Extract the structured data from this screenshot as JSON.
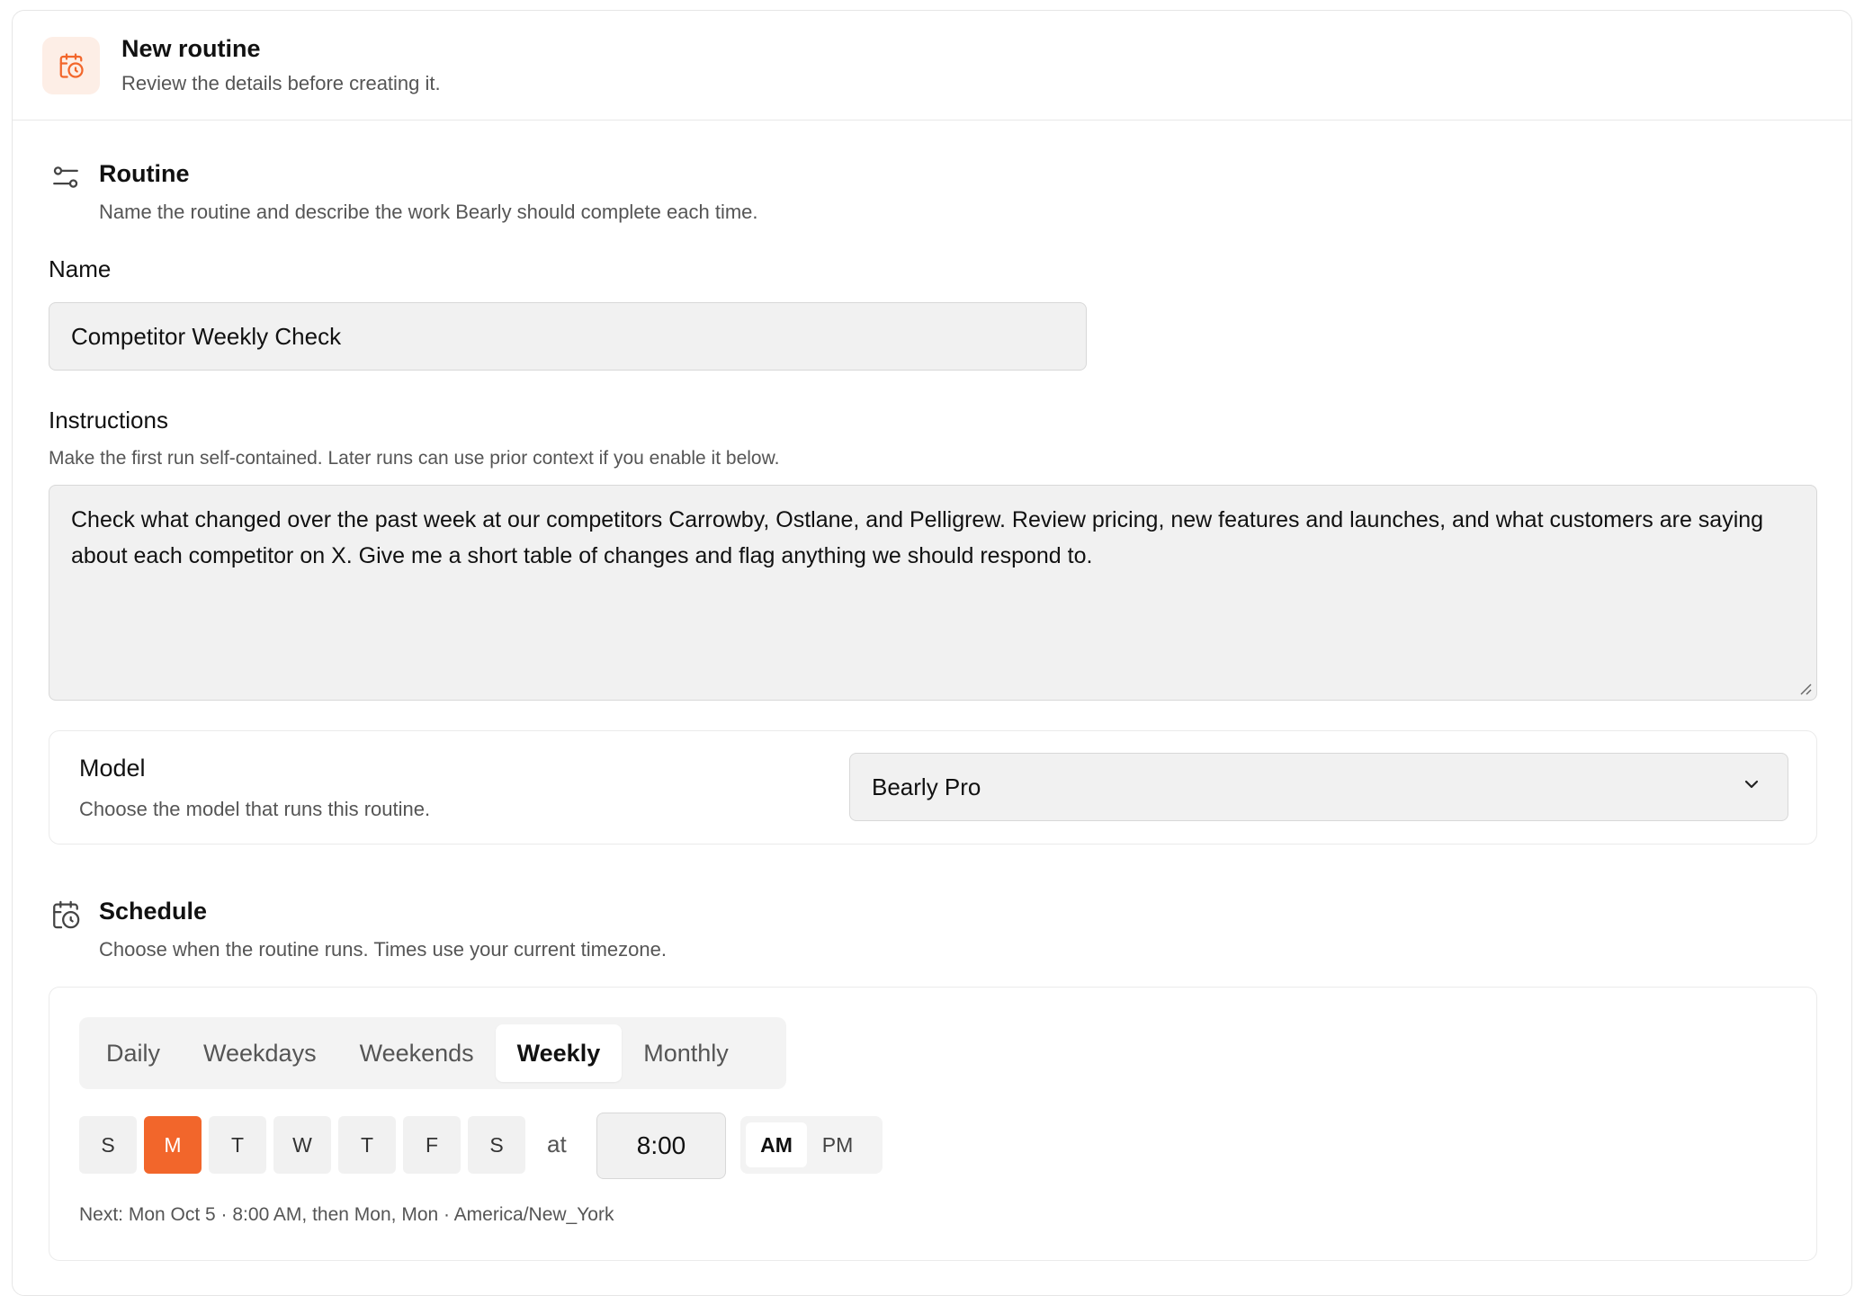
{
  "header": {
    "title": "New routine",
    "subtitle": "Review the details before creating it.",
    "icon": "calendar-clock-icon",
    "accent": "#f2662b"
  },
  "routine": {
    "title": "Routine",
    "subtitle": "Name the routine and describe the work Bearly should complete each time.",
    "name_label": "Name",
    "name_value": "Competitor Weekly Check",
    "instructions_label": "Instructions",
    "instructions_hint": "Make the first run self-contained. Later runs can use prior context if you enable it below.",
    "instructions_value": "Check what changed over the past week at our competitors Carrowby, Ostlane, and Pelligrew. Review pricing, new features and launches, and what customers are saying about each competitor on X. Give me a short table of changes and flag anything we should respond to."
  },
  "model": {
    "title": "Model",
    "subtitle": "Choose the model that runs this routine.",
    "selected": "Bearly Pro"
  },
  "schedule": {
    "title": "Schedule",
    "subtitle": "Choose when the routine runs. Times use your current timezone.",
    "tabs": [
      "Daily",
      "Weekdays",
      "Weekends",
      "Weekly",
      "Monthly"
    ],
    "active_tab": "Weekly",
    "days": [
      "S",
      "M",
      "T",
      "W",
      "T",
      "F",
      "S"
    ],
    "active_day_index": 1,
    "at_label": "at",
    "time": "8:00",
    "am": "AM",
    "pm": "PM",
    "active_period": "AM",
    "next_run": "Next: Mon Oct 5 · 8:00 AM, then Mon, Mon · America/New_York"
  }
}
